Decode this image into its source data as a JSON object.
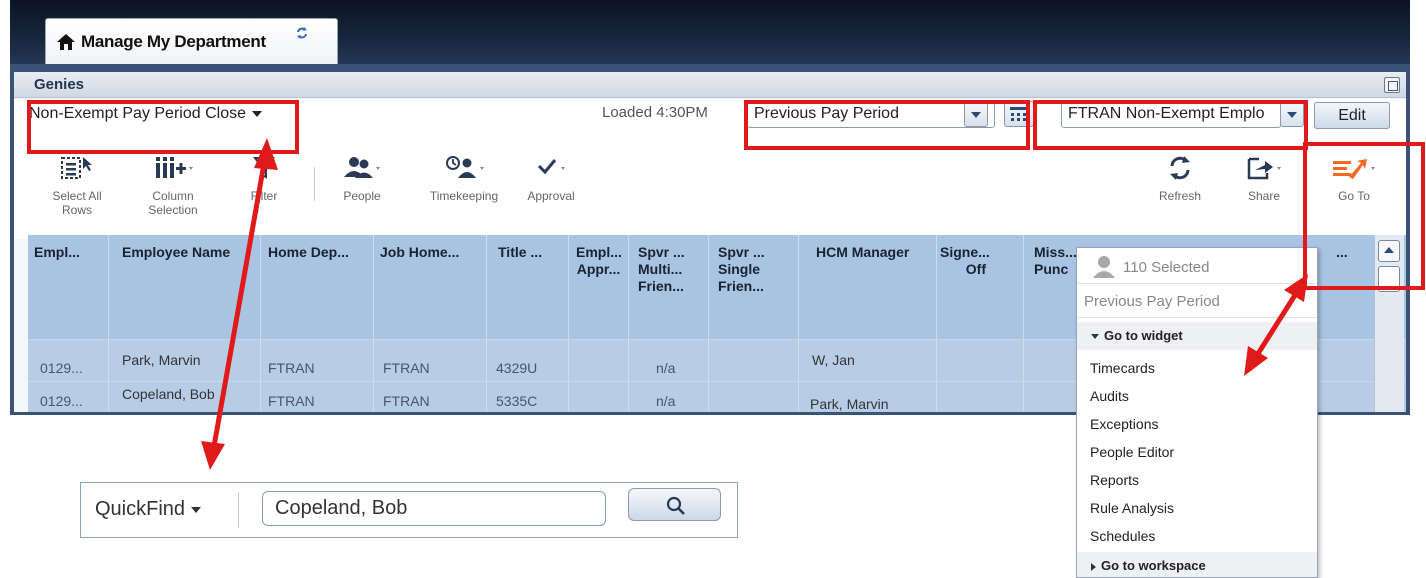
{
  "tab": {
    "title": "Manage My Department"
  },
  "panel": {
    "title": "Genies"
  },
  "controls": {
    "genie_selector": "Non-Exempt Pay Period Close",
    "loaded": "Loaded 4:30PM",
    "timeframe": "Previous Pay Period",
    "hyperfind": "FTRAN Non-Exempt Emplo",
    "edit_label": "Edit"
  },
  "toolbar": {
    "select_all_rows": "Select All Rows",
    "column_selection": "Column Selection",
    "filter": "Filter",
    "people": "People",
    "timekeeping": "Timekeeping",
    "approval": "Approval",
    "refresh": "Refresh",
    "share": "Share",
    "go_to": "Go To"
  },
  "grid": {
    "columns": [
      "Empl...",
      "Employee Name",
      "Home Dep...",
      "Job Home...",
      "Title ...",
      "Empl... Appr...",
      "Spvr ... Multi... Frien...",
      "Spvr ... Single Frien...",
      "HCM Manager",
      "Signe... Off",
      "Miss... Punc",
      "..."
    ],
    "rows": [
      {
        "empl": "0129...",
        "name": "Park, Marvin",
        "home_dept": "FTRAN",
        "job_home": "FTRAN",
        "title": "4329U",
        "spvr_multi": "n/a",
        "hcm_manager": "W, Jan"
      },
      {
        "empl": "0129...",
        "name": "Copeland, Bob",
        "home_dept": "FTRAN",
        "job_home": "FTRAN",
        "title": "5335C",
        "spvr_multi": "n/a",
        "hcm_manager": "Park, Marvin"
      }
    ]
  },
  "goto_menu": {
    "selected": "110 Selected",
    "timeframe": "Previous Pay Period",
    "widget_section": "Go to widget",
    "widget_items": [
      "Timecards",
      "Audits",
      "Exceptions",
      "People Editor",
      "Reports",
      "Rule Analysis",
      "Schedules"
    ],
    "workspace_section": "Go to workspace"
  },
  "quickfind": {
    "label": "QuickFind",
    "value": "Copeland, Bob"
  },
  "colors": {
    "annotation_red": "#e0191b",
    "grid_header": "#a9c4e2",
    "grid_row": "#b7cde6",
    "goto_accent": "#f26a21"
  }
}
